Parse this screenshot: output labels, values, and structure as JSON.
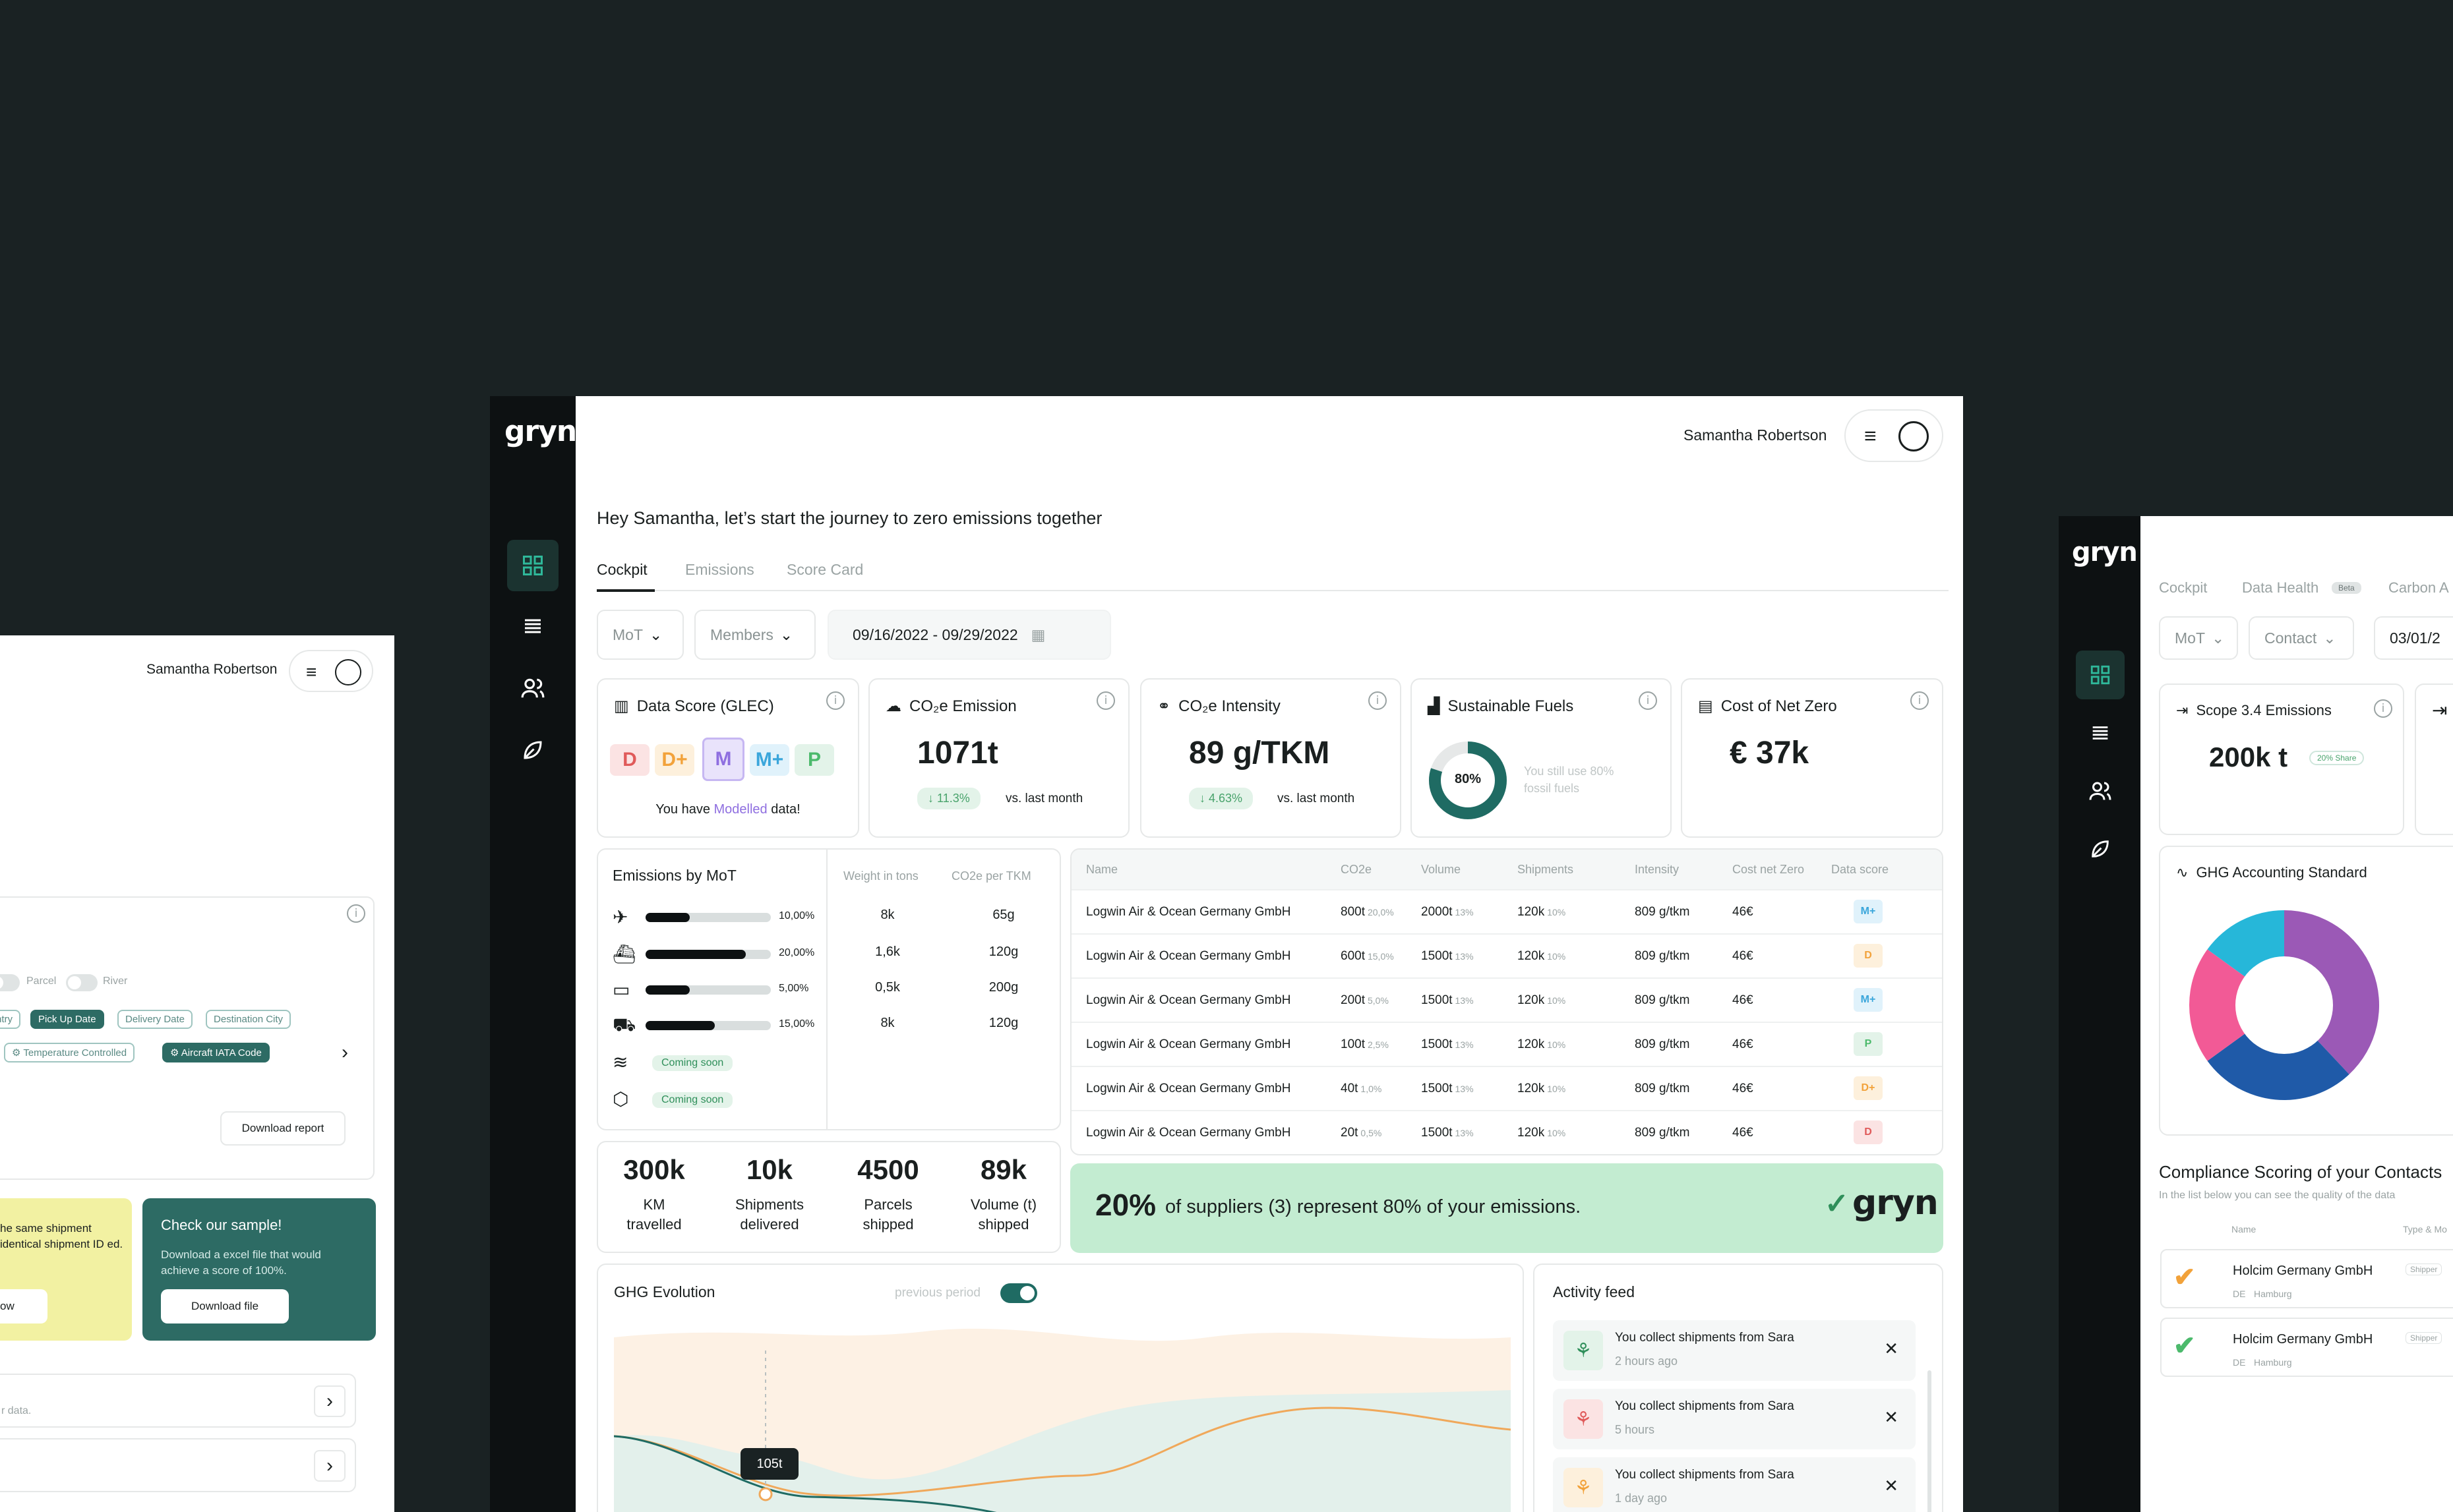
{
  "brand": {
    "logo": "gryn",
    "accent": "#1f6b63",
    "dark": "#0d1112",
    "green_bg": "#c3ecd1"
  },
  "user": {
    "name": "Samantha Robertson"
  },
  "main": {
    "greeting": "Hey Samantha, let’s start the journey to zero emissions together",
    "tabs": [
      {
        "label": "Cockpit",
        "active": true
      },
      {
        "label": "Emissions"
      },
      {
        "label": "Score Card"
      }
    ],
    "filters": {
      "mot": "MoT",
      "members": "Members",
      "date_range": "09/16/2022 - 09/29/2022"
    },
    "kpis": {
      "data_score": {
        "title": "Data Score (GLEC)",
        "grades": [
          "D",
          "D+",
          "M",
          "M+",
          "P"
        ],
        "note_pre": "You have ",
        "note_link": "Modelled",
        "note_post": " data!"
      },
      "co2e": {
        "title": "CO₂e Emission",
        "value": "1071t",
        "delta": "11.3%",
        "vs": "vs. last month"
      },
      "intensity": {
        "title": "CO₂e Intensity",
        "value": "89 g/TKM",
        "delta": "4.63%",
        "vs": "vs. last month"
      },
      "fuels": {
        "title": "Sustainable Fuels",
        "percent": "80%",
        "percent_value": 0.8,
        "note": "You still use 80% fossil fuels"
      },
      "net_zero": {
        "title": "Cost of Net Zero",
        "value": "€ 37k"
      }
    },
    "mot_table": {
      "title": "Emissions by MoT",
      "col1": "Weight in tons",
      "col2": "CO2e per TKM",
      "rows": [
        {
          "icon": "plane-icon",
          "pct": "10,00%",
          "fill": 0.35,
          "weight": "8k",
          "co2": "65g"
        },
        {
          "icon": "ship-icon",
          "pct": "20,00%",
          "fill": 0.8,
          "weight": "1,6k",
          "co2": "120g"
        },
        {
          "icon": "train-icon",
          "pct": "5,00%",
          "fill": 0.35,
          "weight": "0,5k",
          "co2": "200g"
        },
        {
          "icon": "truck-icon",
          "pct": "15,00%",
          "fill": 0.55,
          "weight": "8k",
          "co2": "120g"
        },
        {
          "icon": "river-icon",
          "soon": "Coming soon"
        },
        {
          "icon": "parcel-icon",
          "soon": "Coming soon"
        }
      ]
    },
    "stats": [
      {
        "value": "300k",
        "label1": "KM",
        "label2": "travelled"
      },
      {
        "value": "10k",
        "label1": "Shipments",
        "label2": "delivered"
      },
      {
        "value": "4500",
        "label1": "Parcels",
        "label2": "shipped"
      },
      {
        "value": "89k",
        "label1": "Volume (t)",
        "label2": "shipped"
      }
    ],
    "suppliers": {
      "headers": [
        "Name",
        "CO2e",
        "Volume",
        "Shipments",
        "Intensity",
        "Cost net Zero",
        "Data score"
      ],
      "rows": [
        {
          "name": "Logwin Air & Ocean Germany GmbH",
          "co2": "800t",
          "co2p": "20,0%",
          "vol": "2000t",
          "volp": "13%",
          "ship": "120k",
          "shipp": "10%",
          "int": "809 g/tkm",
          "cost": "46€",
          "score": "M+"
        },
        {
          "name": "Logwin Air & Ocean Germany GmbH",
          "co2": "600t",
          "co2p": "15,0%",
          "vol": "1500t",
          "volp": "13%",
          "ship": "120k",
          "shipp": "10%",
          "int": "809 g/tkm",
          "cost": "46€",
          "score": "D"
        },
        {
          "name": "Logwin Air & Ocean Germany GmbH",
          "co2": "200t",
          "co2p": "5,0%",
          "vol": "1500t",
          "volp": "13%",
          "ship": "120k",
          "shipp": "10%",
          "int": "809 g/tkm",
          "cost": "46€",
          "score": "M+"
        },
        {
          "name": "Logwin Air & Ocean Germany GmbH",
          "co2": "100t",
          "co2p": "2,5%",
          "vol": "1500t",
          "volp": "13%",
          "ship": "120k",
          "shipp": "10%",
          "int": "809 g/tkm",
          "cost": "46€",
          "score": "P"
        },
        {
          "name": "Logwin Air & Ocean Germany GmbH",
          "co2": "40t",
          "co2p": "1,0%",
          "vol": "1500t",
          "volp": "13%",
          "ship": "120k",
          "shipp": "10%",
          "int": "809 g/tkm",
          "cost": "46€",
          "score": "D+"
        },
        {
          "name": "Logwin Air & Ocean Germany GmbH",
          "co2": "20t",
          "co2p": "0,5%",
          "vol": "1500t",
          "volp": "13%",
          "ship": "120k",
          "shipp": "10%",
          "int": "809 g/tkm",
          "cost": "46€",
          "score": "D"
        }
      ]
    },
    "banner": {
      "percent": "20%",
      "text": "of suppliers (3) represent 80% of your emissions.",
      "logo": "gryn"
    },
    "ghg": {
      "title": "GHG Evolution",
      "toggle_label": "previous period",
      "tooltip": "105t"
    },
    "feed": {
      "title": "Activity feed",
      "items": [
        {
          "text": "You collect shipments from Sara",
          "time": "2 hours ago",
          "color": "#2f8f5a",
          "bg": "#e3f3e9"
        },
        {
          "text": "You collect shipments from Sara",
          "time": "5 hours",
          "color": "#e05a5a",
          "bg": "#fbe3e3"
        },
        {
          "text": "You collect shipments from Sara",
          "time": "1 day ago",
          "color": "#f2a23a",
          "bg": "#fdf0dc"
        }
      ]
    }
  },
  "left_window": {
    "toggles": [
      "Parcel",
      "River"
    ],
    "tags_row1": [
      "ntry",
      "Pick Up Date",
      "Delivery Date",
      "Destination City"
    ],
    "tags_row2": [
      "Temperature Controlled",
      "Aircraft IATA Code"
    ],
    "download_report": "Download report",
    "yellow_text": "he same shipment identical shipment ID ed.",
    "yellow_btn": "ow",
    "sample": {
      "title": "Check our sample!",
      "text": "Download a excel file that would achieve a score of 100%.",
      "button": "Download file"
    },
    "data_note": "r data."
  },
  "right_window": {
    "tabs": [
      "Cockpit",
      "Data Health",
      "Carbon A"
    ],
    "beta": "Beta",
    "filters": {
      "mot": "MoT",
      "contact": "Contact",
      "date": "03/01/2"
    },
    "scope": {
      "title": "Scope 3.4 Emissions",
      "value": "200k t",
      "share": "20% Share"
    },
    "ghg_std": {
      "title": "GHG Accounting Standard"
    },
    "compliance": {
      "title": "Compliance Scoring of your Contacts",
      "subtitle": "In the list below you can see the quality of the data",
      "col_name": "Name",
      "col_type": "Type & Mo",
      "rows": [
        {
          "name": "Holcim Germany GmbH",
          "country": "DE",
          "city": "Hamburg",
          "type": "Shipper",
          "color": "#f2a23a"
        },
        {
          "name": "Holcim Germany GmbH",
          "country": "DE",
          "city": "Hamburg",
          "type": "Shipper",
          "color": "#4cba6c"
        }
      ]
    }
  },
  "chart_data": {
    "type": "pie",
    "title": "GHG Accounting Standard",
    "series": [
      {
        "values": [
          38,
          27,
          20,
          15
        ]
      }
    ],
    "colors": [
      "#9b59b6",
      "#1f5aa8",
      "#f25a96",
      "#26b7d9"
    ]
  }
}
